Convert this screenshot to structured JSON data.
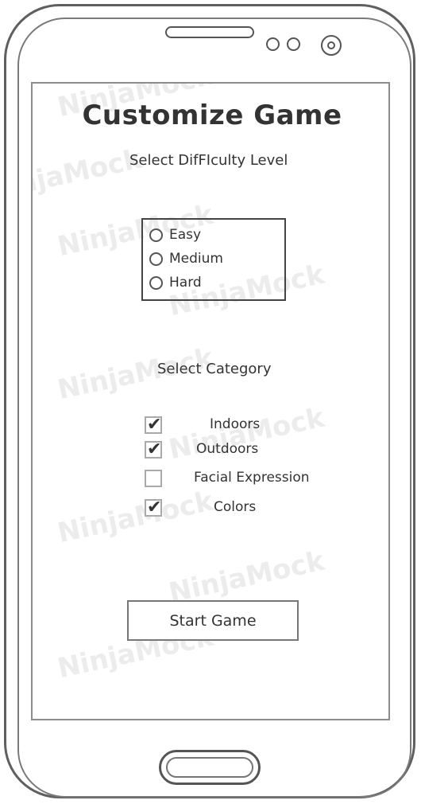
{
  "watermark": "NinjaMock",
  "screen": {
    "title": "Customize Game",
    "difficulty_label": "Select DifFIculty Level",
    "difficulty_options": [
      "Easy",
      "Medium",
      "Hard"
    ],
    "category_label": "Select Category",
    "categories": [
      {
        "label": "Indoors",
        "checked": true
      },
      {
        "label": "Outdoors",
        "checked": true
      },
      {
        "label": "Facial Expression",
        "checked": false
      },
      {
        "label": "Colors",
        "checked": true
      }
    ],
    "start_button": "Start Game"
  }
}
